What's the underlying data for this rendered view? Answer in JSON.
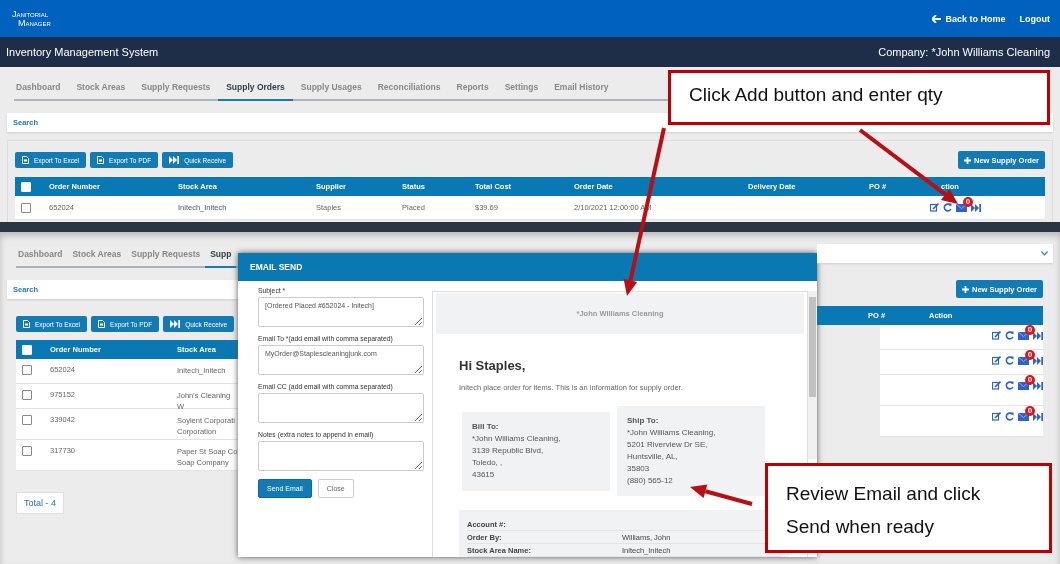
{
  "header": {
    "logo": [
      "Janitorial",
      "Manager"
    ],
    "links": [
      {
        "kind": "back",
        "label": "Back to Home"
      },
      {
        "kind": "plain",
        "label": "Logout"
      }
    ]
  },
  "title_bar": {
    "title": "Inventory Management System",
    "company": "Company: *John Williams Cleaning"
  },
  "top_view": {
    "tabs": [
      {
        "label": "Dashboard",
        "selected": false
      },
      {
        "label": "Stock Areas",
        "selected": false
      },
      {
        "label": "Supply Requests",
        "selected": false
      },
      {
        "label": "Supply Orders",
        "selected": true
      },
      {
        "label": "Supply Usages",
        "selected": false
      },
      {
        "label": "Reconciliations",
        "selected": false
      },
      {
        "label": "Reports",
        "selected": false
      },
      {
        "label": "Settings",
        "selected": false
      },
      {
        "label": "Email History",
        "selected": false
      }
    ],
    "search": "Search",
    "toolbar": [
      {
        "kind": "excel",
        "label": "Export To Excel"
      },
      {
        "kind": "pdf",
        "label": "Export To PDF"
      },
      {
        "kind": "receive",
        "label": "Quick Receive"
      }
    ],
    "new_button": "New Supply Order",
    "table": {
      "select_all": false,
      "columns": [
        "Order Number",
        "Stock Area",
        "Supplier",
        "Status",
        "Total Cost",
        "Order Date",
        "Delivery Date",
        "PO #",
        "ction"
      ],
      "rows": [
        {
          "checked": false,
          "cells": [
            "652024",
            "Initech_Initech",
            "Staples",
            "Placed",
            "$39.69",
            "2/10/2021 12:00:00 AM"
          ],
          "badge": "0"
        }
      ]
    }
  },
  "bottom_view": {
    "tabs": [
      {
        "label": "Dashboard",
        "selected": false
      },
      {
        "label": "Stock Areas",
        "selected": false
      },
      {
        "label": "Supply Requests",
        "selected": false
      },
      {
        "label": "Supp",
        "selected": true
      }
    ],
    "search": "Search",
    "toolbar": [
      {
        "kind": "excel",
        "label": "Export To Excel"
      },
      {
        "kind": "pdf",
        "label": "Export To PDF"
      },
      {
        "kind": "receive",
        "label": "Quick Receive"
      }
    ],
    "new_button": "New Supply Order",
    "table": {
      "select_all": false,
      "columns_left": [
        "Order Number",
        "Stock Area"
      ],
      "columns_right": [
        "PO #",
        "Action"
      ],
      "rows": [
        {
          "checked": false,
          "order_number": "652024",
          "stock_area": [
            "Initech_Initech"
          ],
          "badge": "0"
        },
        {
          "checked": false,
          "order_number": "975152",
          "stock_area": [
            "John's Cleaning W"
          ],
          "badge": "0"
        },
        {
          "checked": false,
          "order_number": "339042",
          "stock_area": [
            "Soylent Corporati",
            "Corporation"
          ],
          "badge": "0"
        },
        {
          "checked": false,
          "order_number": "317730",
          "stock_area": [
            "Paper St Soap Co",
            "Soap Company"
          ],
          "badge": "0"
        }
      ]
    },
    "total": "Total - 4"
  },
  "dialog": {
    "title": "EMAIL SEND",
    "fields": [
      {
        "label": "Subject *",
        "value": "[Ordered Placed #652024 - Initech]"
      },
      {
        "label": "Email To *(add email with comma separated)",
        "value": "MyOrder@Staplescleaningjunk.com"
      },
      {
        "label": "Email CC (add email with comma separated)"
      },
      {
        "label": "Notes (extra notes to append in email)"
      }
    ],
    "buttons": [
      {
        "kind": "primary",
        "label": "Send Email"
      },
      {
        "kind": "secondary",
        "label": "Close"
      }
    ],
    "preview": {
      "company": "*John Williams Cleaning",
      "greeting": "Hi Staples,",
      "message": "Initech place order for items. This is an information for supply order.",
      "addresses": [
        {
          "heading": "Bill To:",
          "lines": [
            "*John Williams Cleaning,",
            "3139 Republic Blvd,",
            "Toledo, ,",
            "43615"
          ]
        },
        {
          "heading": "Ship To:",
          "lines": [
            "*John Williams Cleaning,",
            "5201 Riverview Dr SE,",
            "Huntsville, AL,",
            "35803",
            "(880) 565-12"
          ]
        }
      ],
      "details": [
        {
          "label": "Account #:"
        },
        {
          "label": "Order By:",
          "value": "Williams, John"
        },
        {
          "label": "Stock Area Name:",
          "value": "Initech_Initech"
        }
      ]
    }
  },
  "annotations": [
    {
      "text": "Click Add button and enter qty"
    },
    {
      "text": "Review Email and click Send when ready"
    }
  ]
}
